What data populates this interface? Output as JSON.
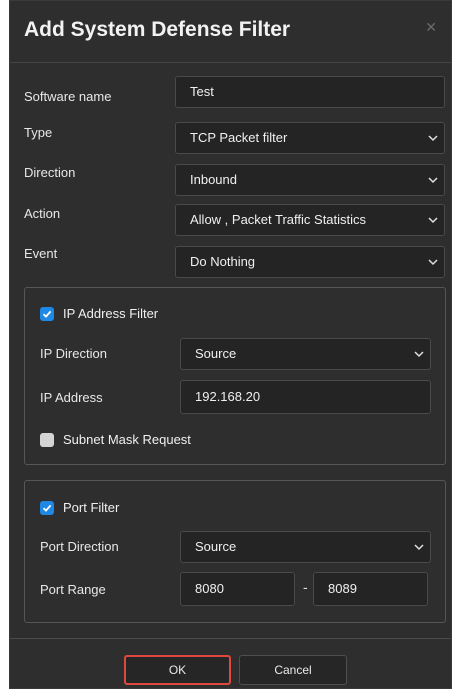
{
  "dialog": {
    "title": "Add System Defense Filter",
    "close_glyph": "✕"
  },
  "form": {
    "software_name": {
      "label": "Software name",
      "value": "Test"
    },
    "type": {
      "label": "Type",
      "value": "TCP Packet filter"
    },
    "direction": {
      "label": "Direction",
      "value": "Inbound"
    },
    "action": {
      "label": "Action",
      "value": "Allow , Packet Traffic Statistics"
    },
    "event": {
      "label": "Event",
      "value": "Do Nothing"
    }
  },
  "ip_filter": {
    "enabled": true,
    "label": "IP Address Filter",
    "direction": {
      "label": "IP Direction",
      "value": "Source"
    },
    "address": {
      "label": "IP Address",
      "value": "192.168.20"
    },
    "subnet": {
      "label": "Subnet Mask Request",
      "checked": false
    }
  },
  "port_filter": {
    "enabled": true,
    "label": "Port Filter",
    "direction": {
      "label": "Port Direction",
      "value": "Source"
    },
    "range": {
      "label": "Port Range",
      "from": "8080",
      "separator": "-",
      "to": "8089"
    }
  },
  "buttons": {
    "ok": "OK",
    "cancel": "Cancel"
  },
  "colors": {
    "accent": "#1e88e5",
    "highlight": "#e0483e",
    "background": "#2e2e2e"
  }
}
